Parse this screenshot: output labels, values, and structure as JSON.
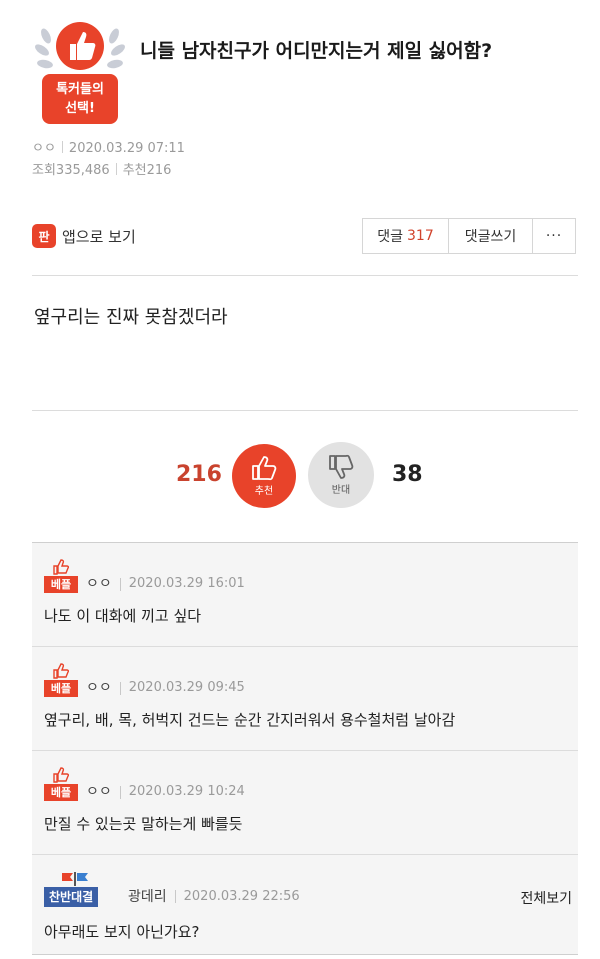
{
  "post": {
    "title": "니들 남자친구가 어디만지는거 제일 싫어함?",
    "badge_line1": "톡커들의",
    "badge_line2": "선택!",
    "author": "ㅇㅇ",
    "date": "2020.03.29 07:11",
    "views_label": "조회",
    "views": "335,486",
    "recommend_label": "추천",
    "recommend_count": "216",
    "body": "옆구리는 진짜 못참겠더라"
  },
  "toolbar": {
    "app_icon": "판",
    "app_label": "앱으로 보기",
    "comments_label": "댓글",
    "comments_count": "317",
    "write_label": "댓글쓰기",
    "more_label": "···"
  },
  "vote": {
    "up_count": "216",
    "up_label": "추천",
    "down_label": "반대",
    "down_count": "38"
  },
  "comments": [
    {
      "tag": "베플",
      "user": "ㅇㅇ",
      "date": "2020.03.29 16:01",
      "text": "나도 이 대화에 끼고 싶다"
    },
    {
      "tag": "베플",
      "user": "ㅇㅇ",
      "date": "2020.03.29 09:45",
      "text": "옆구리, 배, 목, 허벅지 건드는 순간 간지러워서 용수철처럼 날아감"
    },
    {
      "tag": "베플",
      "user": "ㅇㅇ",
      "date": "2020.03.29 10:24",
      "text": "만질 수 있는곳 말하는게 빠를듯"
    },
    {
      "tag": "찬반대결",
      "user": "광데리",
      "date": "2020.03.29 22:56",
      "text": "아무래도 보지 아닌가요?",
      "action": "전체보기"
    }
  ],
  "colors": {
    "accent": "#e8432a",
    "debate": "#3a5fa6"
  },
  "icons": {
    "badge": "thumbs-up-laurel-icon",
    "up": "thumbs-up-icon",
    "down": "thumbs-down-icon"
  }
}
